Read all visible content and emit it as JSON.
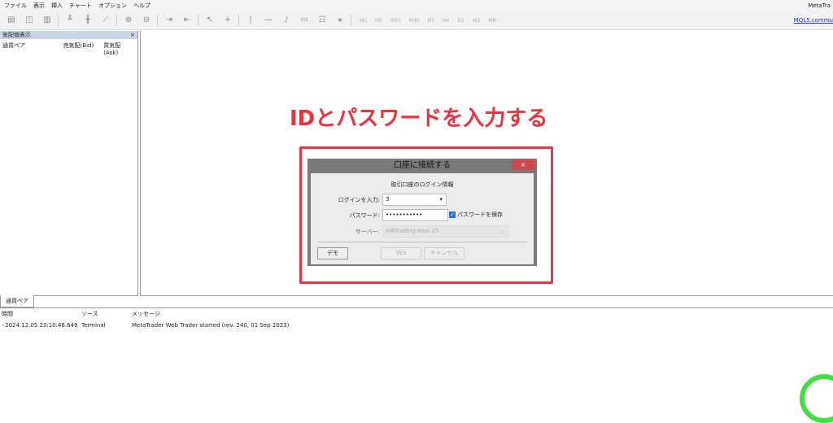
{
  "menu": [
    "ファイル",
    "表示",
    "挿入",
    "チャート",
    "オプション",
    "ヘルプ"
  ],
  "app_title": "MetaTra",
  "timeframes": [
    "M1",
    "M5",
    "M15",
    "M30",
    "H1",
    "H4",
    "D1",
    "W1",
    "MN"
  ],
  "link": "MQL5.commu",
  "market_watch": {
    "title": "気配値表示",
    "close": "×",
    "cols": [
      "通貨ペア",
      "売気配(Bid)",
      "買気配(Ask)"
    ],
    "tab": "通貨ペア"
  },
  "annotation": "IDとパスワードを入力する",
  "dialog": {
    "title": "口座に接続する",
    "close": "×",
    "subtitle": "取引口座のログイン情報",
    "login_label": "ログインを入力:",
    "login_value": "3",
    "password_label": "パスワード:",
    "password_value": "•••••••••••",
    "save_password": "パスワードを保存",
    "server_label": "サーバー:",
    "server_value": "XMTrading-Real 25",
    "demo": "デモ",
    "yes": "YES",
    "cancel": "キャンセル"
  },
  "log": {
    "cols": [
      "時間",
      "ソース",
      "メッセージ"
    ],
    "rows": [
      {
        "time": "2024.12.05 23:10:48.649",
        "source": "Terminal",
        "message": "MetaTrader Web Trader started (rev. 240, 01 Sep 2023)"
      }
    ]
  }
}
